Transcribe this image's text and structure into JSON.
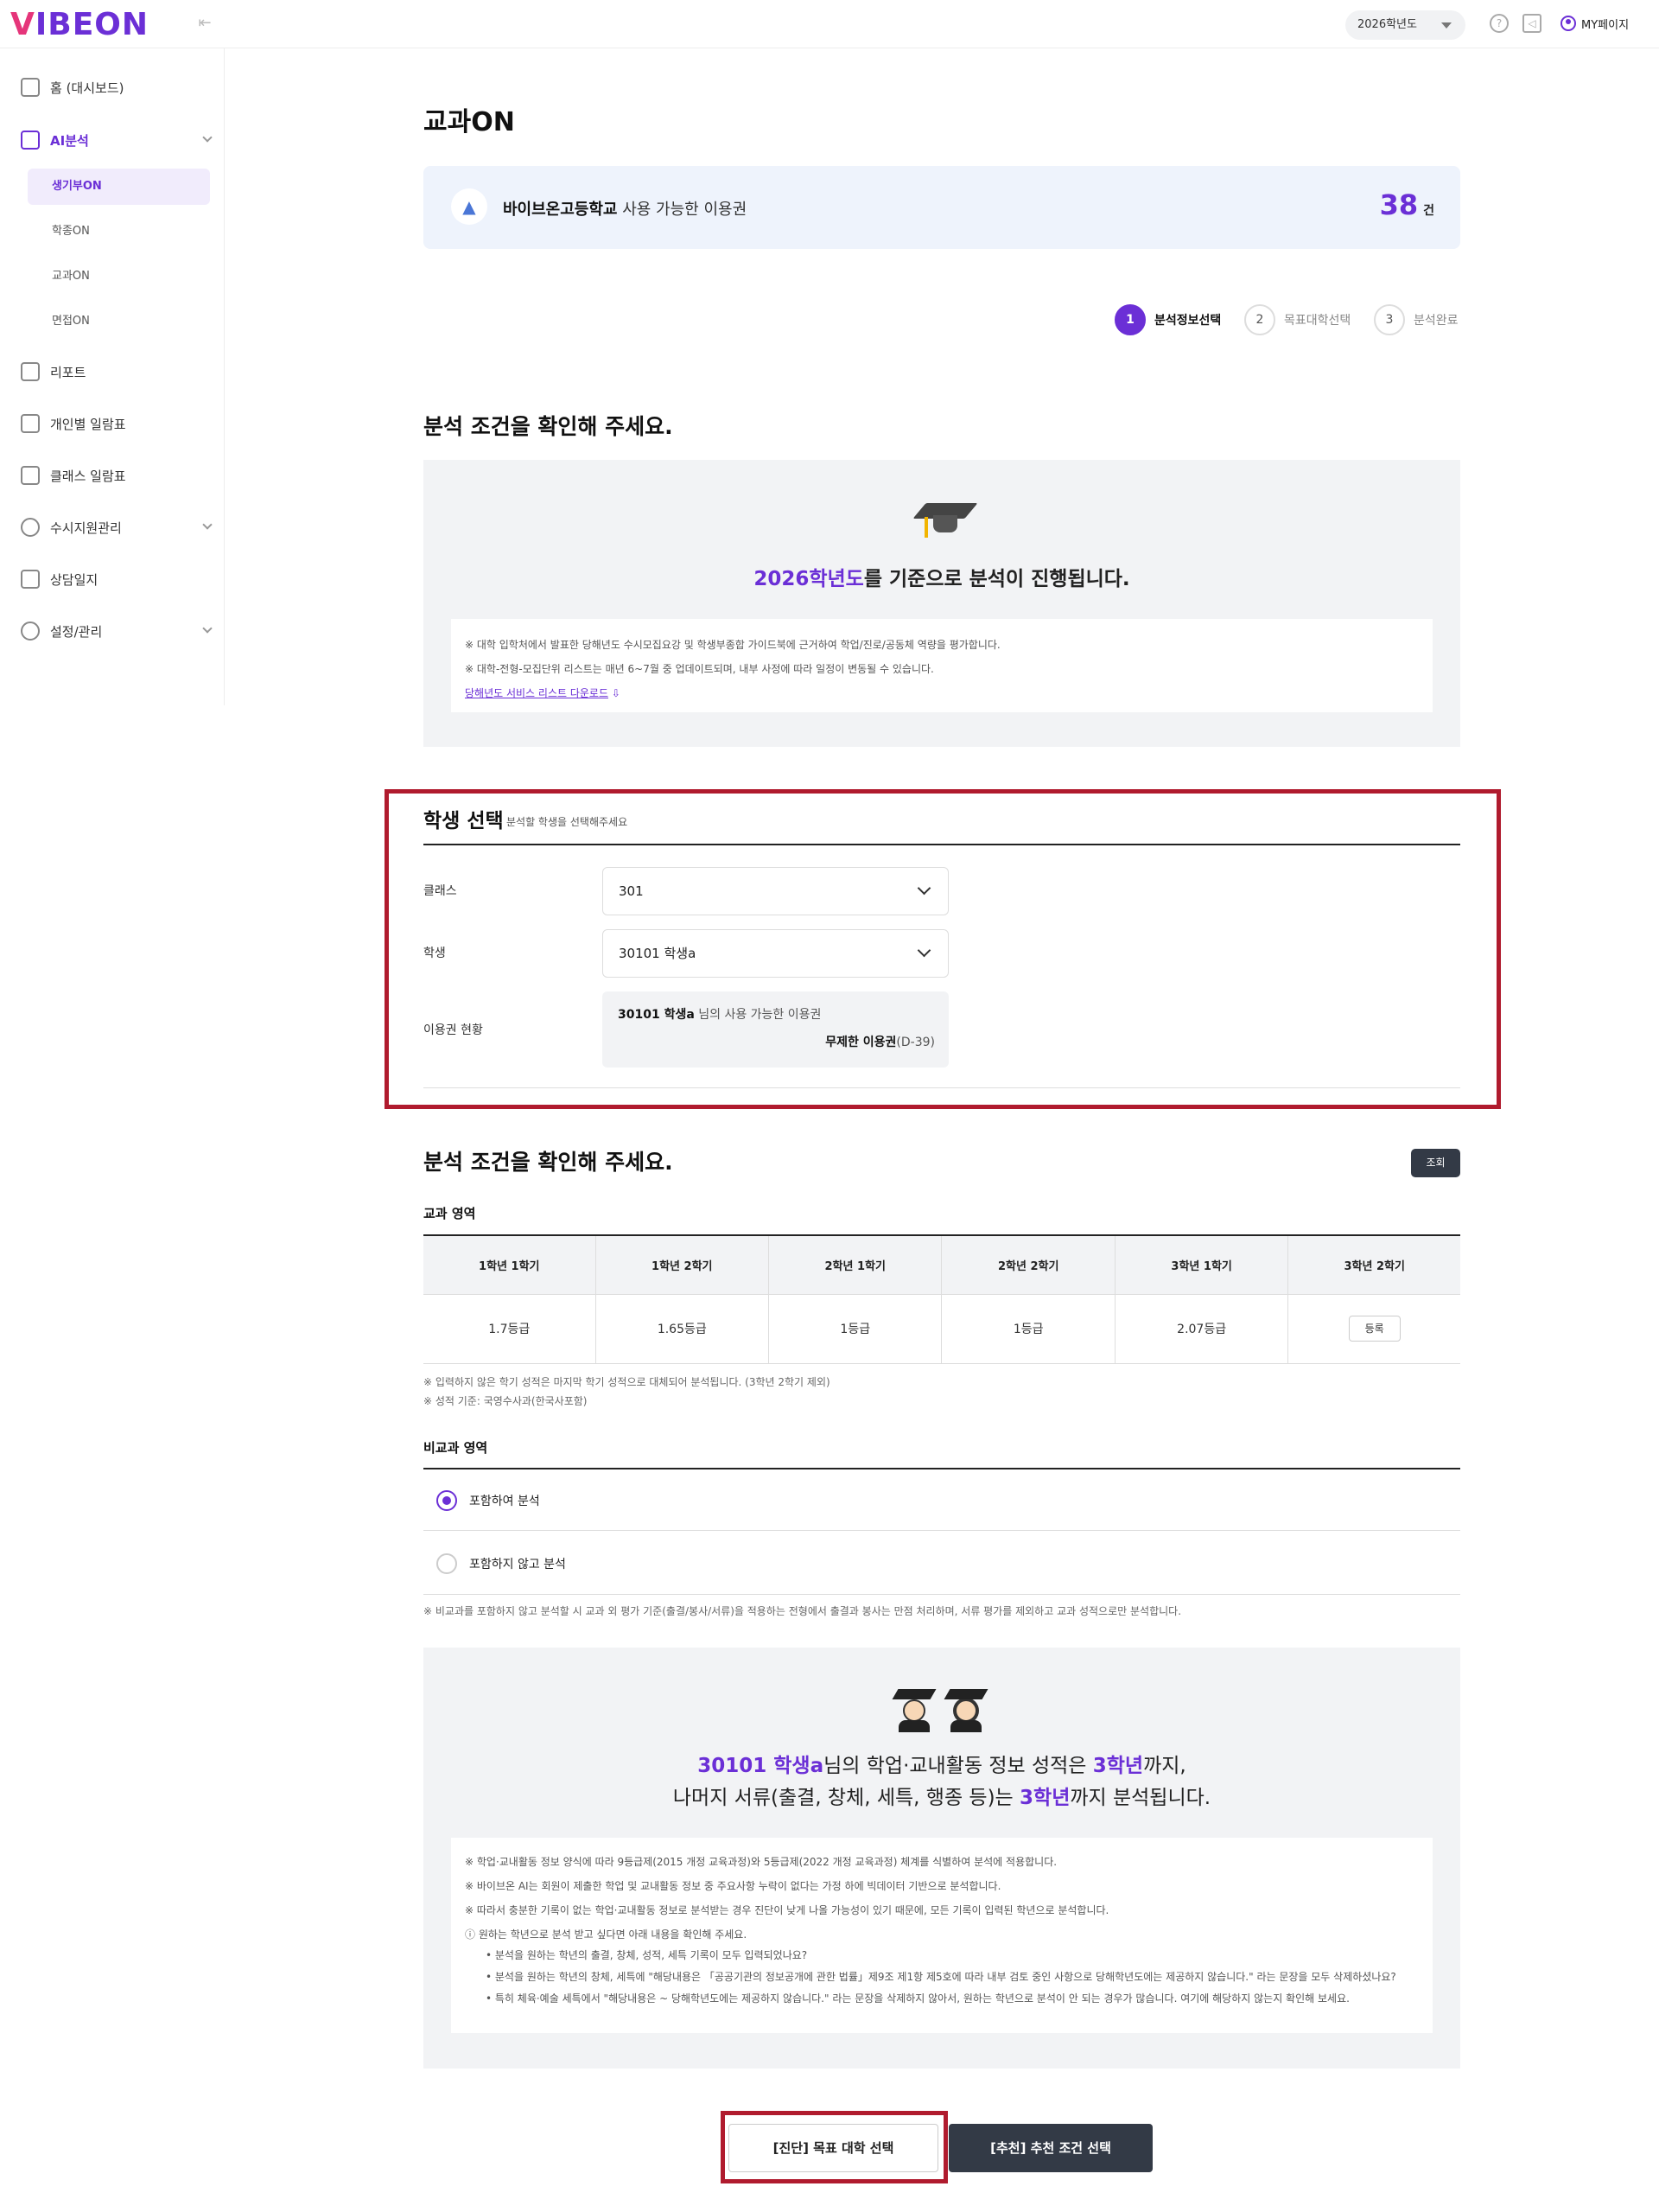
{
  "header": {
    "logo": "VIBEON",
    "year_select": "2026학년도",
    "mypage_label": "MY페이지"
  },
  "sidebar": {
    "items": [
      {
        "label": "홈 (대시보드)",
        "icon": "home-icon"
      },
      {
        "label": "AI분석",
        "icon": "robot-icon",
        "active": true
      },
      {
        "label": "리포트",
        "icon": "chart-icon"
      },
      {
        "label": "개인별 일람표",
        "icon": "phone-doc-icon"
      },
      {
        "label": "클래스 일람표",
        "icon": "phone-doc-icon"
      },
      {
        "label": "수시지원관리",
        "icon": "target-icon"
      },
      {
        "label": "상담일지",
        "icon": "note-icon"
      },
      {
        "label": "설정/관리",
        "icon": "gear-icon"
      }
    ],
    "sub_items": [
      {
        "label": "생기부ON",
        "active": true
      },
      {
        "label": "학종ON"
      },
      {
        "label": "교과ON"
      },
      {
        "label": "면접ON"
      }
    ]
  },
  "main": {
    "title": "교과ON",
    "ticket": {
      "school": "바이브온고등학교",
      "text": " 사용 가능한 이용권",
      "count": "38",
      "unit": "건"
    },
    "steps": [
      {
        "num": "1",
        "label": "분석정보선택",
        "active": true
      },
      {
        "num": "2",
        "label": "목표대학선택"
      },
      {
        "num": "3",
        "label": "분석완료"
      }
    ],
    "confirm_heading": "분석 조건을 확인해 주세요.",
    "year_notice": {
      "year": "2026학년도",
      "rest": "를 기준으로 분석이 진행됩니다."
    },
    "notices": [
      "※ 대학 입학처에서 발표한 당해년도 수시모집요강 및 학생부종합 가이드북에 근거하여 학업/진로/공동체 역량을 평가합니다.",
      "※ 대학-전형-모집단위 리스트는 매년 6~7월 중 업데이트되며, 내부 사정에 따라 일정이 변동될 수 있습니다."
    ],
    "download_link": "당해년도 서비스 리스트 다운로드"
  },
  "student_select": {
    "title": "학생 선택",
    "subtitle": "분석할 학생을 선택해주세요",
    "class_label": "클래스",
    "class_value": "301",
    "student_label": "학생",
    "student_value": "30101 학생a",
    "usage_label": "이용권 현황",
    "usage_name": "30101 학생a",
    "usage_text": " 님의 사용 가능한 이용권",
    "usage_type": "무제한 이용권",
    "usage_days": "(D-39)"
  },
  "conditions": {
    "heading": "분석 조건을 확인해 주세요.",
    "query_button": "조회",
    "subject_area": "교과 영역",
    "columns": [
      "1학년 1학기",
      "1학년 2학기",
      "2학년 1학기",
      "2학년 2학기",
      "3학년 1학기",
      "3학년 2학기"
    ],
    "values": [
      "1.7등급",
      "1.65등급",
      "1등급",
      "1등급",
      "2.07등급"
    ],
    "register_button": "등록",
    "grade_notes": [
      "※ 입력하지 않은 학기 성적은 마지막 학기 성적으로 대체되어 분석됩니다. (3학년 2학기 제외)",
      "※ 성적 기준: 국영수사과(한국사포함)"
    ],
    "non_subject_area": "비교과 영역",
    "radio_include": "포함하여 분석",
    "radio_exclude": "포함하지 않고 분석",
    "radio_note": "※ 비교과를 포함하지 않고 분석할 시 교과 외 평가 기준(출결/봉사/서류)을 적용하는 전형에서 출결과 봉사는 만점 처리하며, 서류 평가를 제외하고 교과 성적으로만 분석합니다."
  },
  "summary": {
    "name": "30101 학생a",
    "l1_mid": "님의 학업·교내활동 정보 성적은 ",
    "l1_grade": "3학년",
    "l1_end": "까지,",
    "l2_start": "나머지 서류(출결, 창체, 세특, 행종 등)는 ",
    "l2_grade": "3학년",
    "l2_end": "까지 분석됩니다.",
    "notes": [
      "※ 학업·교내활동 정보 양식에 따라 9등급제(2015 개정 교육과정)와 5등급제(2022 개정 교육과정) 체계를 식별하여 분석에 적용합니다.",
      "※ 바이브온 AI는 회원이 제출한 학업 및 교내활동 정보 중 주요사항 누락이 없다는 가정 하에 빅데이터 기반으로 분석합니다.",
      "※ 따라서 충분한 기록이 없는 학업·교내활동 정보로 분석받는 경우 진단이 낮게 나올 가능성이 있기 때문에, 모든 기록이 입력된 학년으로 분석합니다.",
      "ⓘ 원하는 학년으로 분석 받고 싶다면 아래 내용을 확인해 주세요."
    ],
    "bullets": [
      "• 분석을 원하는 학년의 출결, 창체, 성적, 세특 기록이 모두 입력되었나요?",
      "• 분석을 원하는 학년의 창체, 세특에 \"해당내용은 「공공기관의 정보공개에 관한 법률」제9조 제1항 제5호에 따라 내부 검토 중인 사항으로 당해학년도에는 제공하지 않습니다.\" 라는 문장을 모두 삭제하셨나요?",
      "• 특히 체육·예술 세특에서 \"해당내용은 ~ 당해학년도에는 제공하지 않습니다.\" 라는 문장을 삭제하지 않아서, 원하는 학년으로 분석이 안 되는 경우가 많습니다. 여기에 해당하지 않는지 확인해 보세요."
    ]
  },
  "actions": {
    "diagnose": "[진단] 목표 대학 선택",
    "recommend": "[추천] 추천 조건 선택"
  },
  "colors": {
    "accent": "#6b2fd6",
    "highlight_border": "#b01b2e",
    "dark_button": "#333a46"
  }
}
